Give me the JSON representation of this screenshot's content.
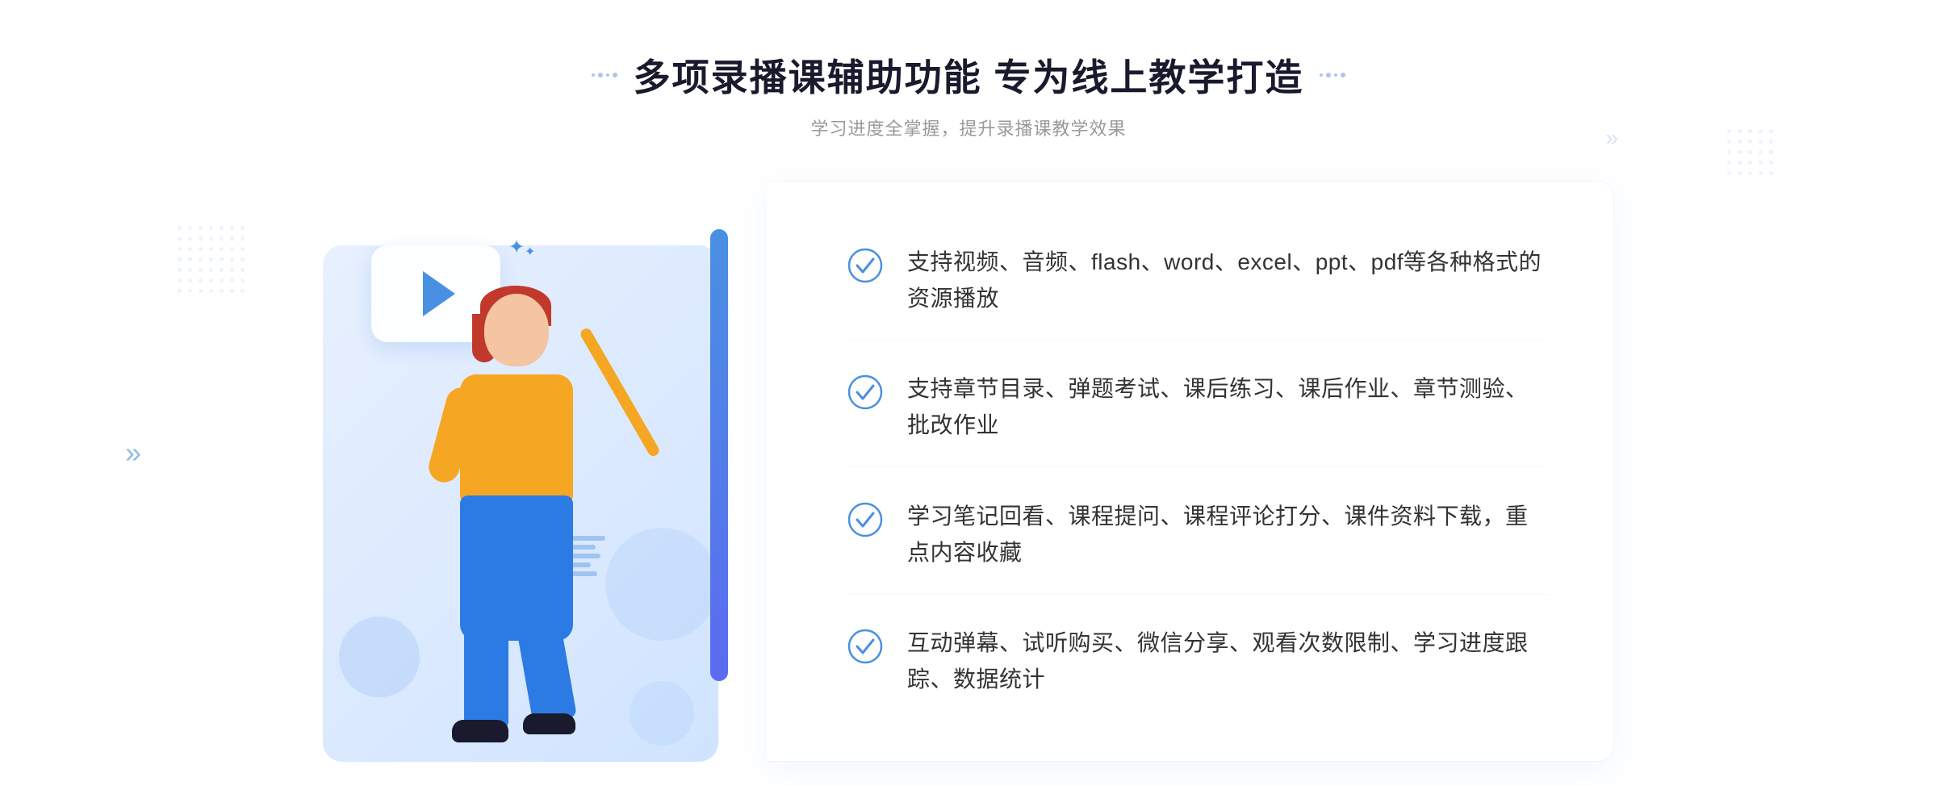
{
  "header": {
    "title": "多项录播课辅助功能 专为线上教学打造",
    "subtitle": "学习进度全掌握，提升录播课教学效果",
    "title_deco_left": ":::",
    "title_deco_right": ":::"
  },
  "features": [
    {
      "id": 1,
      "text": "支持视频、音频、flash、word、excel、ppt、pdf等各种格式的资源播放"
    },
    {
      "id": 2,
      "text": "支持章节目录、弹题考试、课后练习、课后作业、章节测验、批改作业"
    },
    {
      "id": 3,
      "text": "学习笔记回看、课程提问、课程评论打分、课件资料下载，重点内容收藏"
    },
    {
      "id": 4,
      "text": "互动弹幕、试听购买、微信分享、观看次数限制、学习进度跟踪、数据统计"
    }
  ],
  "colors": {
    "primary_blue": "#4a90e2",
    "dark_blue": "#2c5fbd",
    "text_dark": "#1a1a2e",
    "text_gray": "#999999",
    "text_body": "#333333",
    "bg_light": "#f0f4ff",
    "accent": "#5b6bf0"
  }
}
